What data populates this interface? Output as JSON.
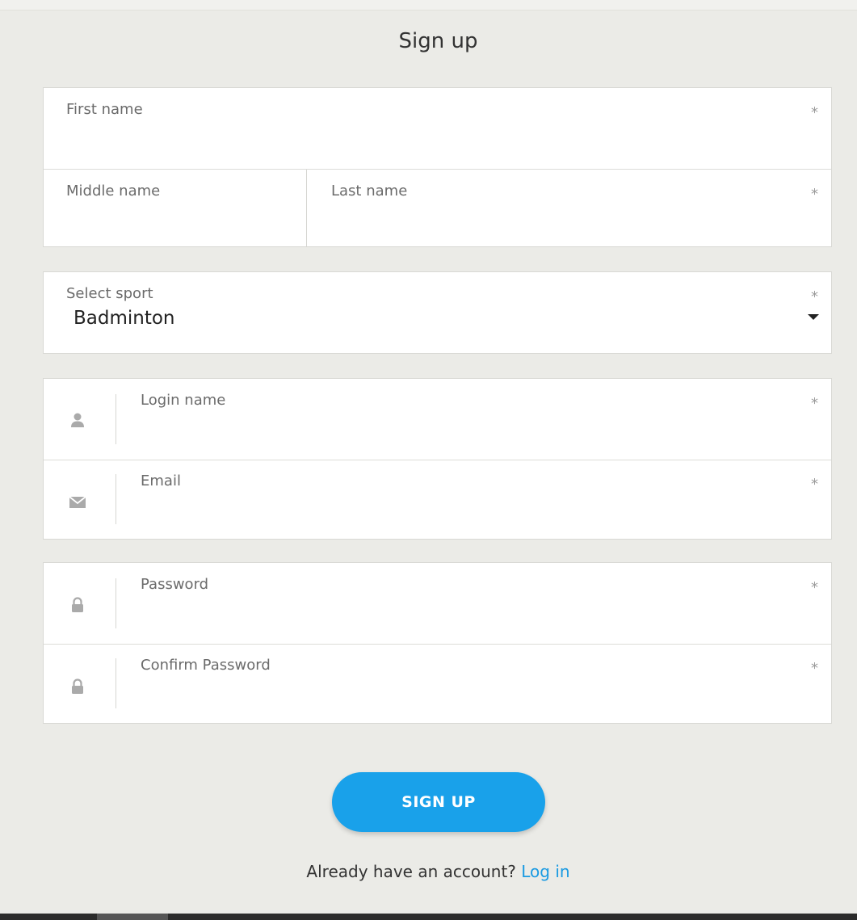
{
  "form": {
    "title": "Sign up",
    "required_mark": "*",
    "fields": {
      "first_name": "First name",
      "middle_name": "Middle name",
      "last_name": "Last name",
      "select_sport_label": "Select sport",
      "select_sport_value": "Badminton",
      "login_name": "Login name",
      "email": "Email",
      "password": "Password",
      "confirm_password": "Confirm Password"
    },
    "submit_label": "SIGN UP",
    "footer_prompt": "Already have an account?",
    "footer_link": "Log in"
  },
  "icons": {
    "login": "user-icon",
    "email": "envelope-icon",
    "password": "lock-icon",
    "confirm_password": "lock-icon",
    "select": "caret-down-icon"
  },
  "colors": {
    "accent": "#19a1ea",
    "link": "#1a9ae2",
    "background": "#ebebe7"
  }
}
